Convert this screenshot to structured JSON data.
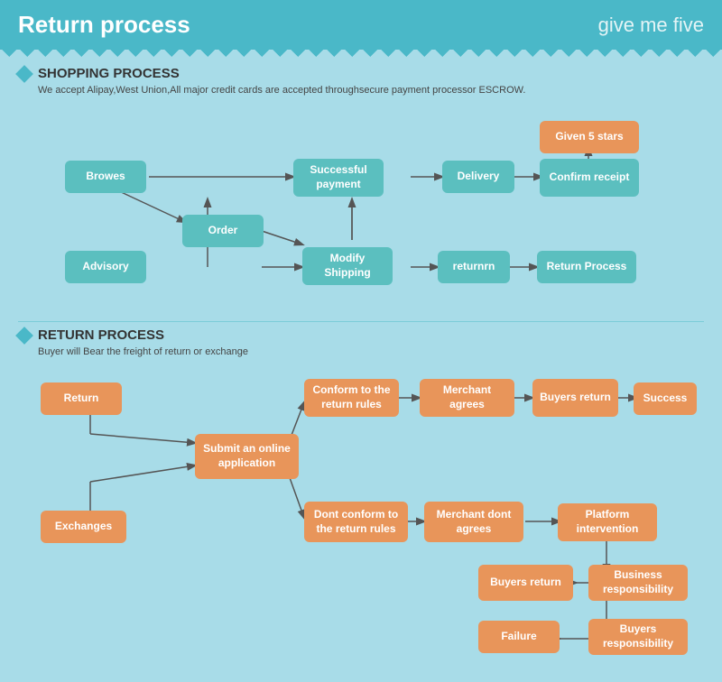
{
  "header": {
    "title": "Return process",
    "logo": "give me five"
  },
  "shopping": {
    "section_title": "SHOPPING PROCESS",
    "description": "We accept Alipay,West Union,All major credit cards are accepted throughsecure payment processor ESCROW.",
    "boxes": {
      "browes": "Browes",
      "order": "Order",
      "advisory": "Advisory",
      "successful_payment": "Successful payment",
      "modify_shipping": "Modify Shipping",
      "delivery": "Delivery",
      "confirm_receipt": "Confirm receipt",
      "given_5_stars": "Given 5 stars",
      "returnrn": "returnrn",
      "return_process": "Return Process"
    }
  },
  "return": {
    "section_title": "RETURN PROCESS",
    "description": "Buyer will Bear the freight of return or exchange",
    "boxes": {
      "return": "Return",
      "exchanges": "Exchanges",
      "submit_online": "Submit an online application",
      "conform_return": "Conform to the return rules",
      "dont_conform": "Dont conform to the return rules",
      "merchant_agrees": "Merchant agrees",
      "merchant_dont": "Merchant dont agrees",
      "buyers_return_1": "Buyers return",
      "buyers_return_2": "Buyers return",
      "success": "Success",
      "platform_intervention": "Platform intervention",
      "business_responsibility": "Business responsibility",
      "buyers_responsibility": "Buyers responsibility",
      "failure": "Failure"
    }
  }
}
